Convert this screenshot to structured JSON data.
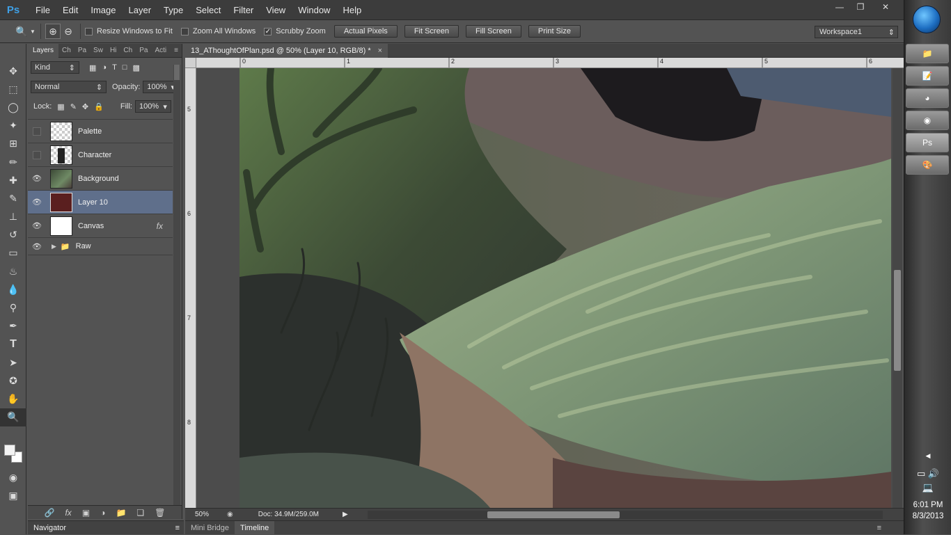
{
  "app": {
    "logo": "Ps",
    "menu": [
      "File",
      "Edit",
      "Image",
      "Layer",
      "Type",
      "Select",
      "Filter",
      "View",
      "Window",
      "Help"
    ]
  },
  "options": {
    "resize_windows": "Resize Windows to Fit",
    "zoom_all": "Zoom All Windows",
    "scrubby": "Scrubby Zoom",
    "actual_pixels": "Actual Pixels",
    "fit_screen": "Fit Screen",
    "fill_screen": "Fill Screen",
    "print_size": "Print Size",
    "workspace": "Workspace1"
  },
  "layers_panel": {
    "tabs": [
      "Layers",
      "Ch",
      "Pa",
      "Sw",
      "Hi",
      "Ch",
      "Pa",
      "Acti"
    ],
    "filter": "Kind",
    "blend_mode": "Normal",
    "opacity_label": "Opacity:",
    "opacity": "100%",
    "lock_label": "Lock:",
    "fill_label": "Fill:",
    "fill": "100%",
    "layers": [
      {
        "name": "Palette",
        "visible": false
      },
      {
        "name": "Character",
        "visible": false
      },
      {
        "name": "Background",
        "visible": true
      },
      {
        "name": "Layer 10",
        "visible": true,
        "selected": true
      },
      {
        "name": "Canvas",
        "visible": true,
        "fx": "fx"
      },
      {
        "name": "Raw",
        "visible": true,
        "group": true
      }
    ]
  },
  "document": {
    "tab_title": "13_AThoughtOfPlan.psd @ 50% (Layer 10, RGB/8) *",
    "ruler_h": [
      "0",
      "1",
      "2",
      "3",
      "4",
      "5",
      "6"
    ],
    "ruler_v": [
      "5",
      "6",
      "7",
      "8"
    ],
    "zoom": "50%",
    "doc_info": "Doc: 34.9M/259.0M"
  },
  "bottom": {
    "navigator": "Navigator",
    "mini_bridge": "Mini Bridge",
    "timeline": "Timeline"
  },
  "taskbar": {
    "time": "6:01 PM",
    "date": "8/3/2013"
  }
}
